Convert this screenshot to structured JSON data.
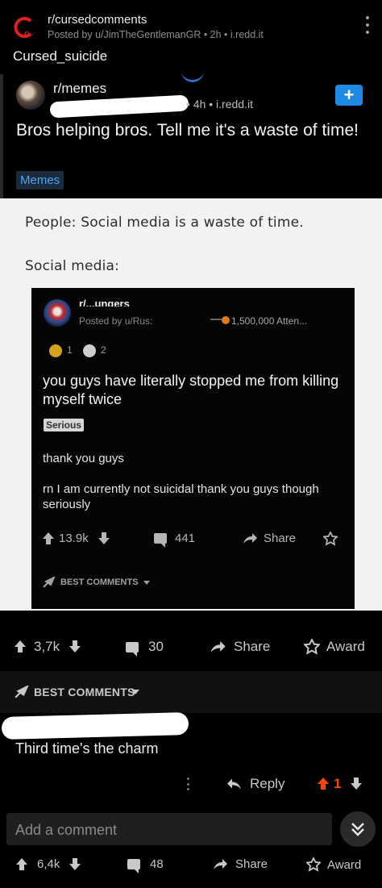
{
  "header": {
    "subreddit": "r/cursedcomments",
    "meta": "Posted by u/JimTheGentlemanGR • 2h • i.redd.it",
    "title": "Cursed_suicide"
  },
  "embedded_post": {
    "subreddit": "r/memes",
    "meta": "• 4h • i.redd.it",
    "plus_label": "+",
    "title": "Bros helping bros. Tell me it's a waste of time!",
    "flair": "Memes"
  },
  "meme": {
    "line1": "People: Social media is a waste of time.",
    "line2": "Social media:",
    "card": {
      "subreddit": "r/...ungers",
      "meta": "Posted by u/Rus:",
      "attendance": "1,500,000 Atten...",
      "awards": [
        {
          "icon": "gold-award-icon",
          "count": "1",
          "color": "#d4a21e"
        },
        {
          "icon": "silver-award-icon",
          "count": "2",
          "color": "#cfcfcf"
        }
      ],
      "title": "you guys have literally stopped me from killing myself twice",
      "flair": "Serious",
      "body1": "thank you guys",
      "body2": "rn I am currently not suicidal thank you guys though seriously",
      "votes": "13.9k",
      "comments": "441",
      "share": "Share",
      "best_comments": "BEST COMMENTS"
    }
  },
  "post_actions": {
    "votes": "3,7k",
    "comments": "30",
    "share": "Share",
    "award": "Award"
  },
  "comments_section": {
    "sort_label": "BEST COMMENTS",
    "comment_text": "Third time's the charm",
    "reply": "Reply",
    "comment_votes": "1"
  },
  "composer": {
    "placeholder": "Add a comment"
  },
  "bottom_bar": {
    "votes": "6,4k",
    "comments": "48",
    "share": "Share",
    "award": "Award"
  },
  "colors": {
    "accent_blue": "#1f8ae3",
    "upvote_orange": "#ff4500",
    "logo_red": "#e02020"
  }
}
